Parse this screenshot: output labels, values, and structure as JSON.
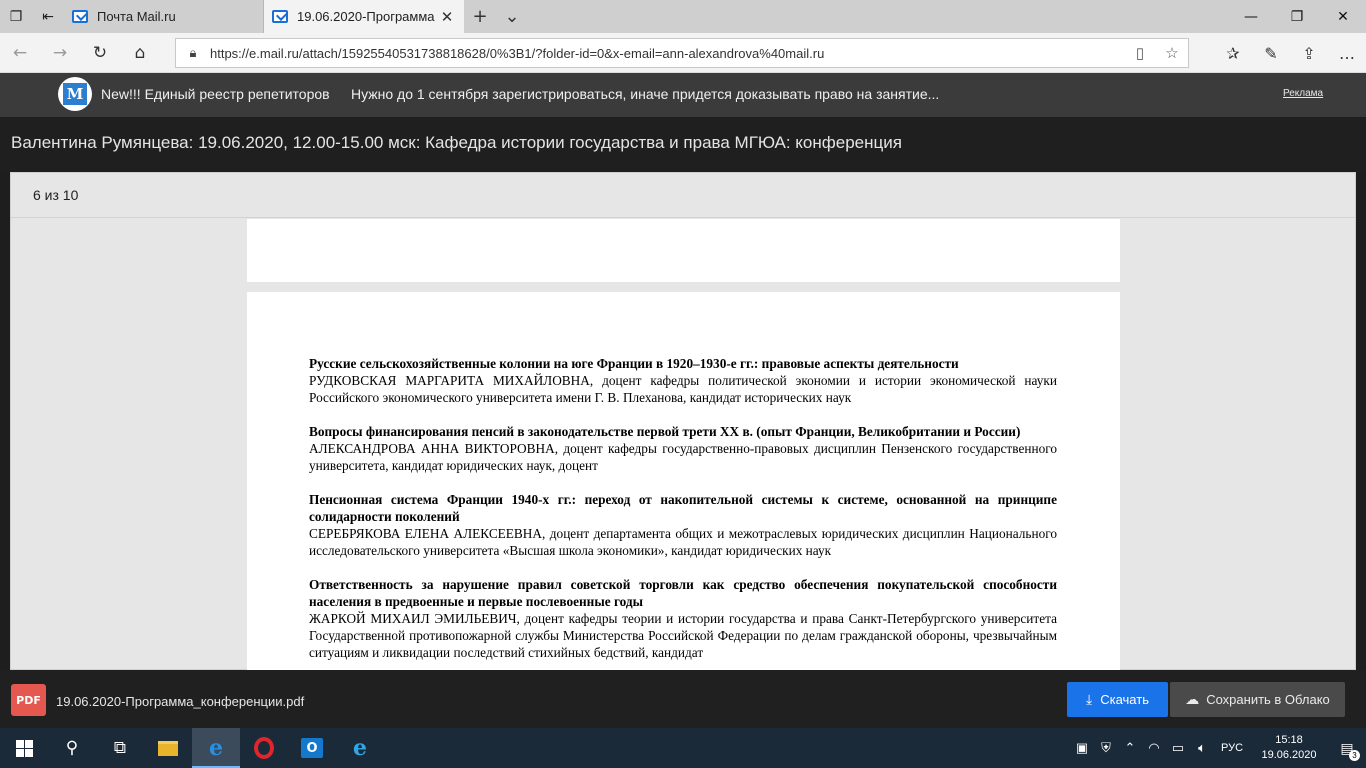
{
  "browser": {
    "tabs": [
      {
        "label": "Почта Mail.ru",
        "active": false
      },
      {
        "label": "19.06.2020-Программа",
        "active": true
      }
    ],
    "url": "https://e.mail.ru/attach/15925540531738818628/0%3B1/?folder-id=0&x-email=ann-alexandrova%40mail.ru"
  },
  "ad": {
    "logo_letter": "M",
    "text1": "New!!! Единый реестр репетиторов",
    "text2": "Нужно до 1 сентября зарегистрироваться, иначе придется доказывать право на занятие...",
    "link": "Реклама"
  },
  "viewer": {
    "title": "Валентина Румянцева: 19.06.2020, 12.00-15.00 мск: Кафедра истории государства и права МГЮА: конференция",
    "pager": "6 из 10"
  },
  "document": {
    "entries": [
      {
        "head": "Русские сельскохозяйственные колонии на юге Франции в 1920–1930-е гг.: правовые аспекты деятельности",
        "body": "РУДКОВСКАЯ МАРГАРИТА МИХАЙЛОВНА, доцент кафедры политической экономии и истории экономической науки Российского экономического университета имени Г. В. Плеханова, кандидат исторических наук"
      },
      {
        "head": "Вопросы финансирования пенсий в законодательстве первой трети XX в. (опыт Франции, Великобритании и России)",
        "body": "АЛЕКСАНДРОВА АННА ВИКТОРОВНА, доцент кафедры государственно-правовых дисциплин Пензенского государственного университета, кандидат юридических наук, доцент"
      },
      {
        "head": "Пенсионная система Франции 1940-х гг.: переход от накопительной системы к системе, основанной на принципе солидарности поколений",
        "body": "СЕРЕБРЯКОВА ЕЛЕНА АЛЕКСЕЕВНА, доцент департамента общих и межотраслевых юридических дисциплин Национального исследовательского университета «Высшая школа экономики», кандидат юридических наук"
      },
      {
        "head": "Ответственность за нарушение правил советской торговли как средство обеспечения покупательской способности населения в предвоенные и первые послевоенные годы",
        "body": "ЖАРКОЙ МИХАИЛ ЭМИЛЬЕВИЧ, доцент кафедры теории и истории государства и права Санкт-Петербургского университета Государственной противопожарной службы Министерства Российской Федерации по делам гражданской обороны, чрезвычайным ситуациям и ликвидации последствий стихийных бедствий, кандидат"
      }
    ]
  },
  "download": {
    "file_badge": "PDF",
    "filename": "19.06.2020-Программа_конференции.pdf",
    "download_label": "Скачать",
    "cloud_label": "Сохранить в Облако"
  },
  "taskbar": {
    "language": "РУС",
    "time": "15:18",
    "date": "19.06.2020",
    "notifications": "3"
  },
  "colors": {
    "accent": "#1a73e8",
    "pdf": "#e5584f",
    "taskbar": "#1b2a38"
  }
}
